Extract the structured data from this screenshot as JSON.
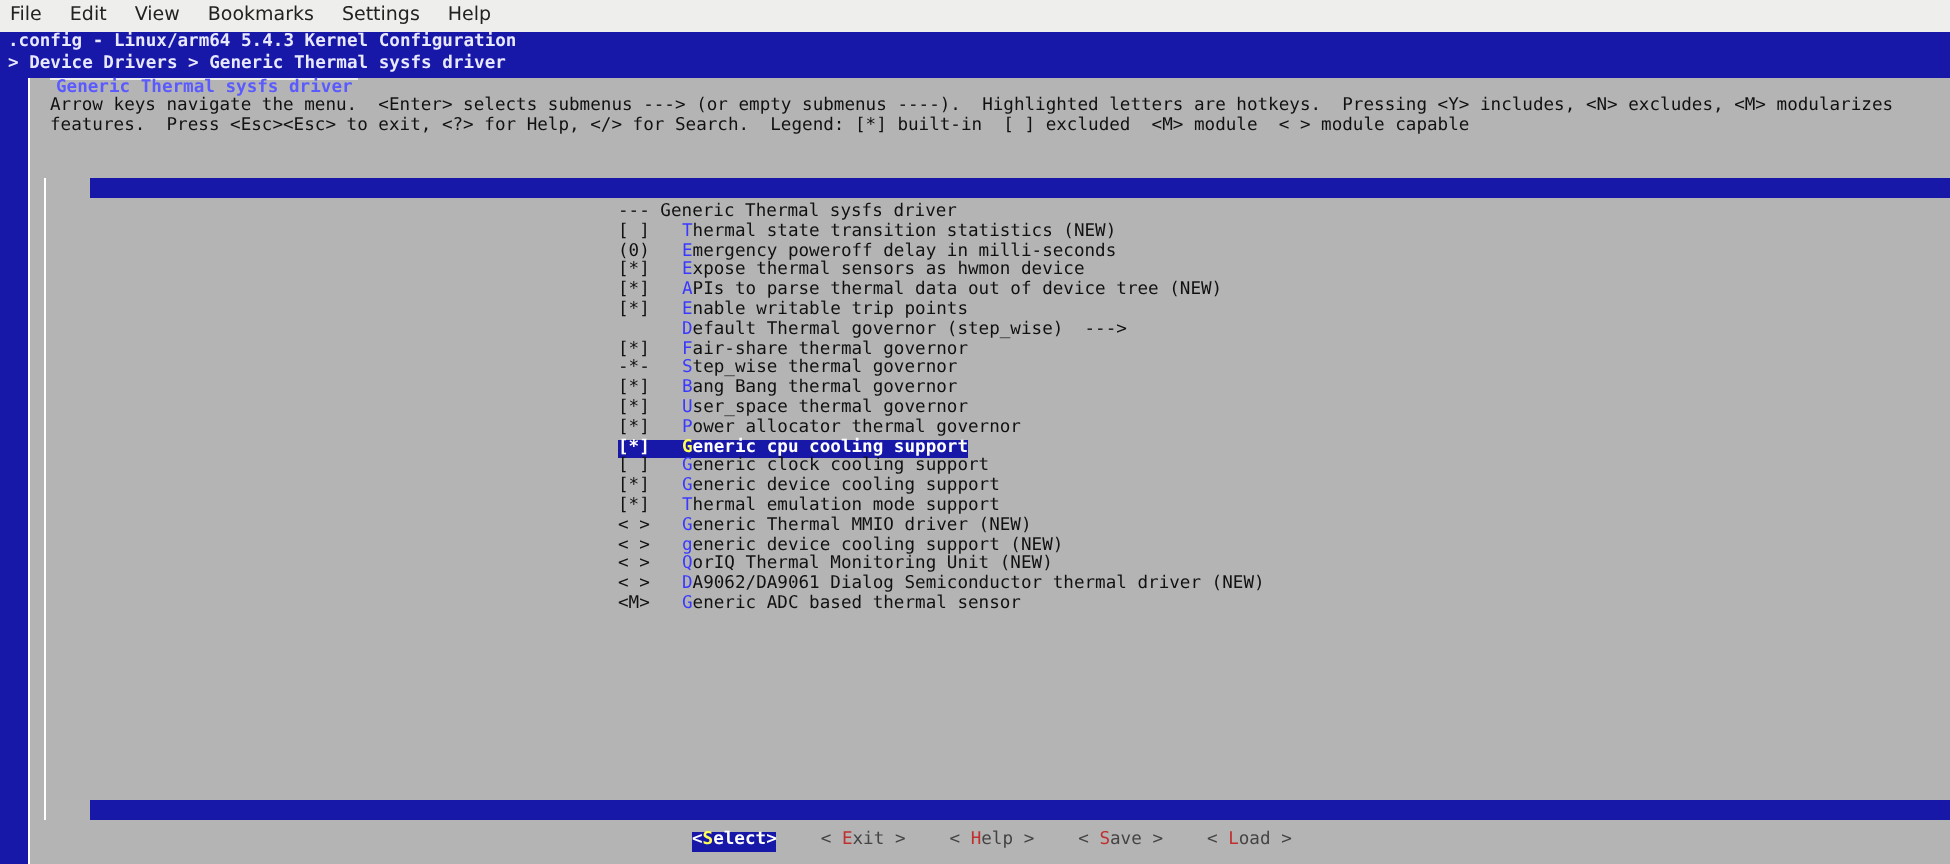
{
  "menubar": [
    "File",
    "Edit",
    "View",
    "Bookmarks",
    "Settings",
    "Help"
  ],
  "header": {
    "title": ".config - Linux/arm64 5.4.3 Kernel Configuration",
    "breadcrumb": "> Device Drivers > Generic Thermal sysfs driver"
  },
  "dialog": {
    "title": "Generic Thermal sysfs driver",
    "help": [
      "Arrow keys navigate the menu.  <Enter> selects submenus ---> (or empty submenus ----).  Highlighted letters are hotkeys.  Pressing <Y> includes, <N> excludes, <M> modularizes",
      "features.  Press <Esc><Esc> to exit, <?> for Help, </> for Search.  Legend: [*] built-in  [ ] excluded  <M> module  < > module capable"
    ],
    "items": [
      {
        "kind": "comment",
        "label": "--- Generic Thermal sysfs driver",
        "selected": false
      },
      {
        "kind": "option",
        "prefix": "[ ]",
        "label": "Thermal state transition statistics (NEW)",
        "selected": false
      },
      {
        "kind": "option",
        "prefix": "(0)",
        "label": "Emergency poweroff delay in milli-seconds",
        "selected": false
      },
      {
        "kind": "option",
        "prefix": "[*]",
        "label": "Expose thermal sensors as hwmon device",
        "selected": false
      },
      {
        "kind": "option",
        "prefix": "[*]",
        "label": "APIs to parse thermal data out of device tree (NEW)",
        "selected": false
      },
      {
        "kind": "option",
        "prefix": "[*]",
        "label": "Enable writable trip points",
        "selected": false
      },
      {
        "kind": "option",
        "label": "Default Thermal governor (step_wise)  --->",
        "selected": false
      },
      {
        "kind": "option",
        "prefix": "[*]",
        "label": "Fair-share thermal governor",
        "selected": false
      },
      {
        "kind": "option",
        "prefix": "-*-",
        "label": "Step_wise thermal governor",
        "selected": false
      },
      {
        "kind": "option",
        "prefix": "[*]",
        "label": "Bang Bang thermal governor",
        "selected": false
      },
      {
        "kind": "option",
        "prefix": "[*]",
        "label": "User_space thermal governor",
        "selected": false
      },
      {
        "kind": "option",
        "prefix": "[*]",
        "label": "Power allocator thermal governor",
        "selected": false
      },
      {
        "kind": "option",
        "prefix": "[*]",
        "label": "Generic cpu cooling support",
        "selected": true
      },
      {
        "kind": "option",
        "prefix": "[ ]",
        "label": "Generic clock cooling support",
        "selected": false
      },
      {
        "kind": "option",
        "prefix": "[*]",
        "label": "Generic device cooling support",
        "selected": false
      },
      {
        "kind": "option",
        "prefix": "[*]",
        "label": "Thermal emulation mode support",
        "selected": false
      },
      {
        "kind": "option",
        "prefix": "< >",
        "label": "Generic Thermal MMIO driver (NEW)",
        "selected": false
      },
      {
        "kind": "option",
        "prefix": "< >",
        "label": "generic device cooling support (NEW)",
        "selected": false
      },
      {
        "kind": "option",
        "prefix": "< >",
        "label": "QorIQ Thermal Monitoring Unit (NEW)",
        "selected": false
      },
      {
        "kind": "option",
        "prefix": "< >",
        "label": "DA9062/DA9061 Dialog Semiconductor thermal driver (NEW)",
        "selected": false
      },
      {
        "kind": "option",
        "prefix": "<M>",
        "label": "Generic ADC based thermal sensor",
        "selected": false
      }
    ],
    "buttons": [
      {
        "label": "<Select>",
        "selected": true
      },
      {
        "label": "< Exit >",
        "selected": false
      },
      {
        "label": "< Help >",
        "selected": false
      },
      {
        "label": "< Save >",
        "selected": false
      },
      {
        "label": "< Load >",
        "selected": false
      }
    ]
  }
}
